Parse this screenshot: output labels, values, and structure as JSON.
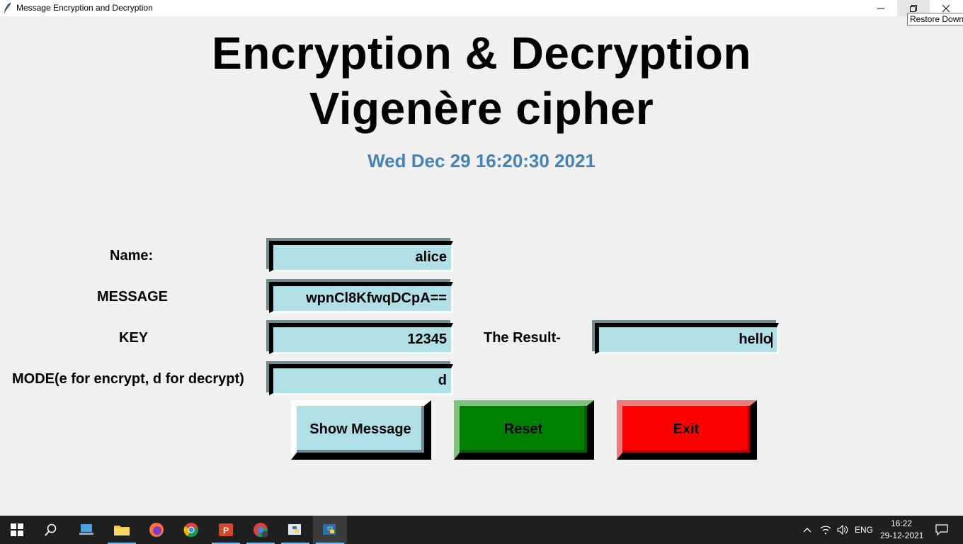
{
  "window": {
    "title": "Message Encryption and Decryption",
    "tooltip": "Restore Down"
  },
  "header": {
    "title_line1": "Encryption & Decryption",
    "title_line2": "Vigenère cipher",
    "datetime": "Wed Dec 29 16:20:30 2021"
  },
  "form": {
    "name_label": "Name:",
    "name_value": "alice",
    "message_label": "MESSAGE",
    "message_value": "wpnCl8KfwqDCpA==",
    "key_label": "KEY",
    "key_value": "12345",
    "mode_label": "MODE(e for encrypt, d for decrypt)",
    "mode_value": "d",
    "result_label": "The Result-",
    "result_value": "hello"
  },
  "buttons": {
    "show_label": "Show Message",
    "reset_label": "Reset",
    "exit_label": "Exit"
  },
  "taskbar": {
    "items": [
      "start-icon",
      "search-icon",
      "file-explorer-app-icon",
      "folder-icon",
      "firefox-icon",
      "chrome-icon",
      "powerpoint-icon",
      "chrome-profile-icon",
      "python-idle-icon",
      "python-tk-icon"
    ],
    "language": "ENG",
    "time": "16:22",
    "date": "29-12-2021"
  },
  "colors": {
    "entry_bg": "#b0dfe6",
    "datetime": "#4682b4",
    "reset_bg": "#008000",
    "exit_bg": "#ff0000"
  }
}
